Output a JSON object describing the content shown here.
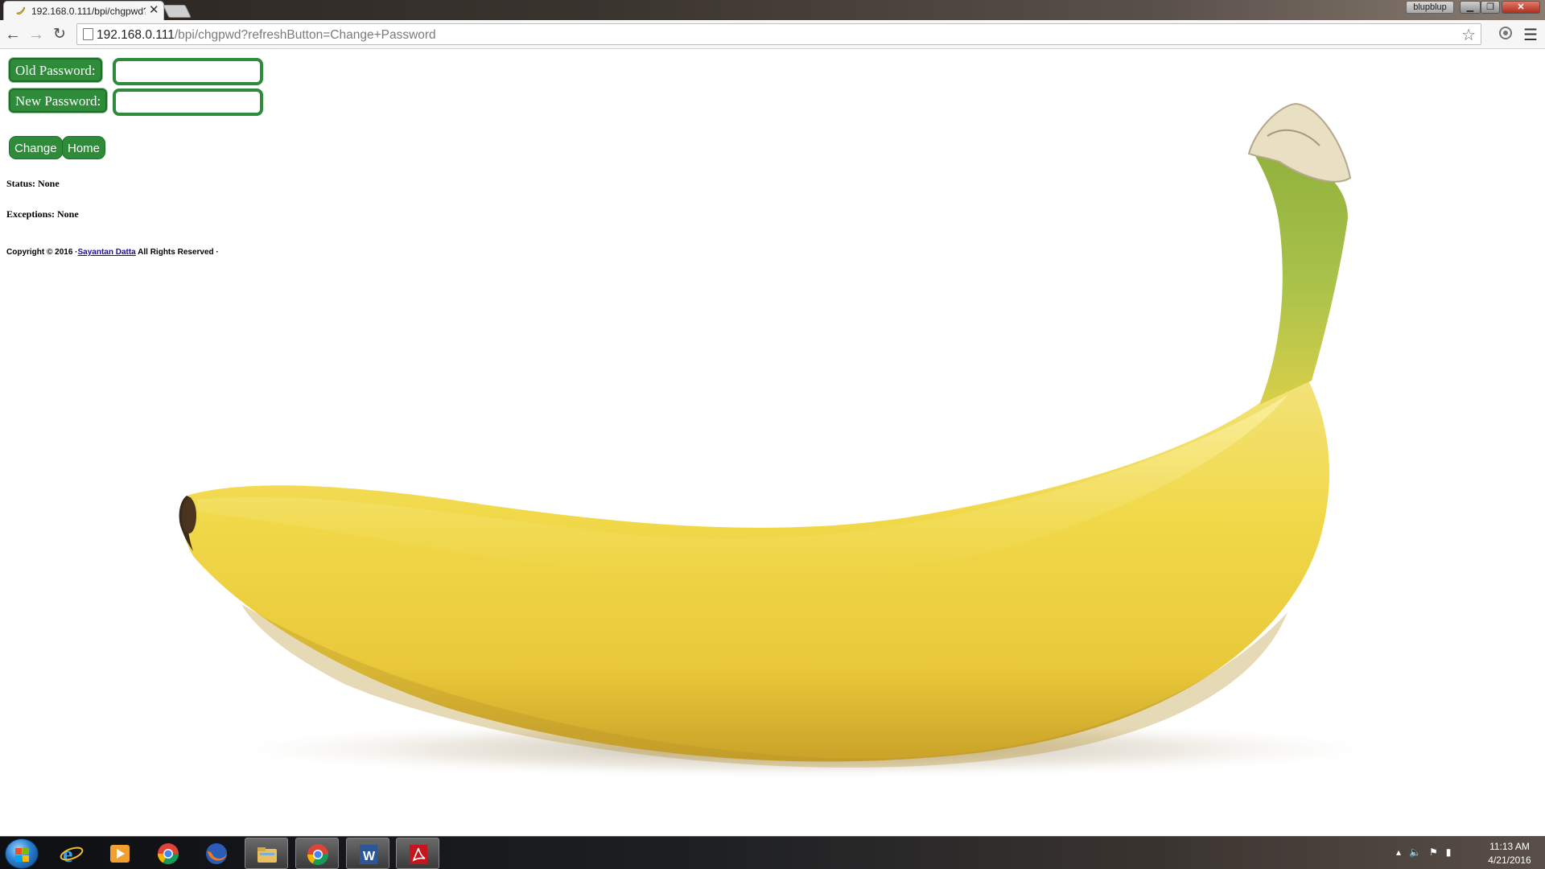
{
  "browser": {
    "tab_title": "192.168.0.111/bpi/chgpwd?refreshButton=Change+Password",
    "tab_close": "✕",
    "profile_name": "blupblup",
    "url_host": "192.168.0.111",
    "url_path": "/bpi/chgpwd?refreshButton=Change+Password"
  },
  "form": {
    "old_password_label": "Old Password:",
    "new_password_label": "New Password:",
    "old_password_value": "",
    "new_password_value": "",
    "change_button": "Change",
    "home_button": "Home"
  },
  "status": {
    "status_text": "Status: None",
    "exceptions_text": "Exceptions: None"
  },
  "footer": {
    "copyright_prefix": "Copyright © 2016 ·",
    "author_link": "Sayantan Datta",
    "rights": " All Rights Reserved ·"
  },
  "taskbar": {
    "apps": [
      "internet-explorer",
      "media-player",
      "chrome",
      "firefox",
      "file-explorer",
      "chrome-active",
      "word",
      "acrobat"
    ],
    "time": "11:13 AM",
    "date": "4/21/2016"
  },
  "colors": {
    "accent_green": "#2e8b3a",
    "banana_yellow": "#f2dc4a"
  }
}
